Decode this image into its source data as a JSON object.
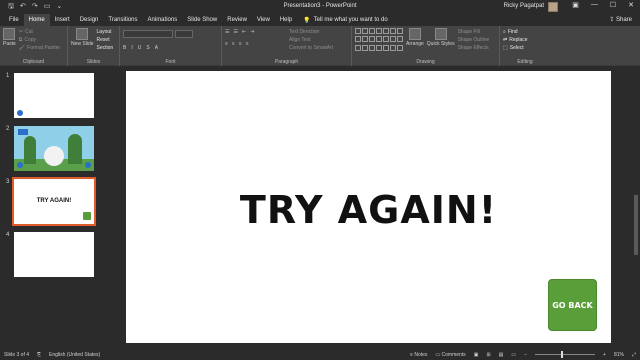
{
  "window": {
    "title": "Presentation3 - PowerPoint",
    "user": "Ricky Pagatpat",
    "share": "Share"
  },
  "tabs": [
    "File",
    "Home",
    "Insert",
    "Design",
    "Transitions",
    "Animations",
    "Slide Show",
    "Review",
    "View",
    "Help"
  ],
  "active_tab": "Home",
  "tell_me": "Tell me what you want to do",
  "ribbon": {
    "clipboard": {
      "label": "Clipboard",
      "paste": "Paste",
      "cut": "Cut",
      "copy": "Copy",
      "format_painter": "Format Painter"
    },
    "slides": {
      "label": "Slides",
      "new_slide": "New Slide",
      "layout": "Layout",
      "reset": "Reset",
      "section": "Section"
    },
    "font": {
      "label": "Font"
    },
    "paragraph": {
      "label": "Paragraph",
      "text_direction": "Text Direction",
      "align_text": "Align Text",
      "smartart": "Convert to SmartArt"
    },
    "drawing": {
      "label": "Drawing",
      "arrange": "Arrange",
      "quick_styles": "Quick Styles",
      "shape_fill": "Shape Fill",
      "shape_outline": "Shape Outline",
      "shape_effects": "Shape Effects"
    },
    "editing": {
      "label": "Editing",
      "find": "Find",
      "replace": "Replace",
      "select": "Select"
    }
  },
  "thumbnails": [
    {
      "num": "1"
    },
    {
      "num": "2"
    },
    {
      "num": "3",
      "text": "TRY AGAIN!"
    },
    {
      "num": "4"
    }
  ],
  "slide": {
    "title": "TRY AGAIN!",
    "button": "GO BACK"
  },
  "status": {
    "slide": "Slide 3 of 4",
    "language": "English (United States)",
    "notes": "Notes",
    "comments": "Comments",
    "zoom": "81%"
  }
}
